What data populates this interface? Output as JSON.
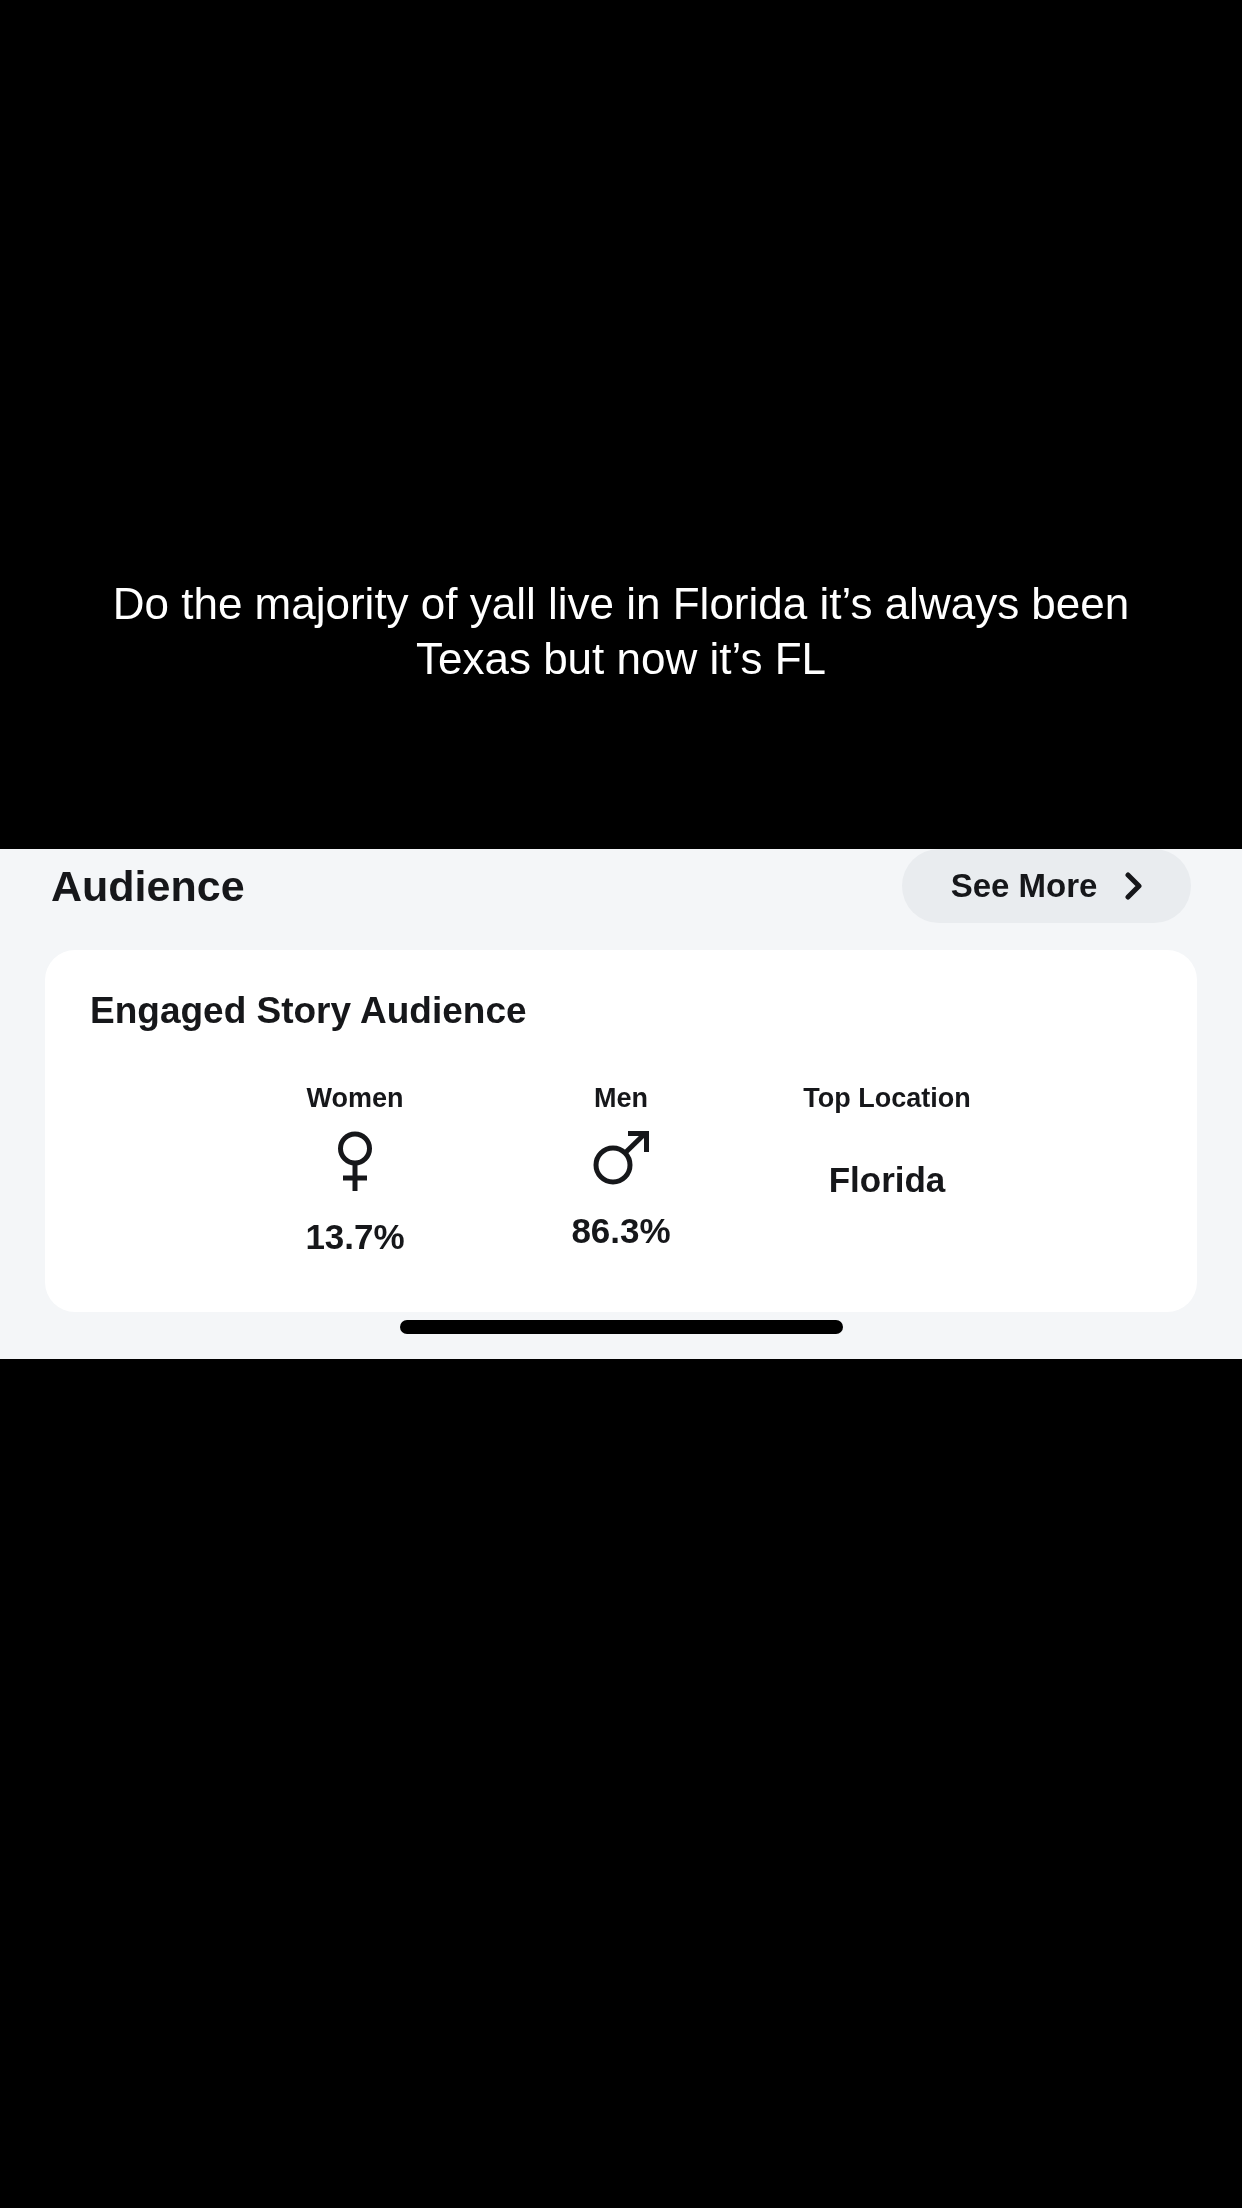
{
  "caption": "Do the majority of yall live in Florida it’s always been Texas but now it’s FL",
  "section": {
    "title": "Audience",
    "button": "See More"
  },
  "card": {
    "title": "Engaged Story Audience",
    "stats": [
      {
        "kind": "female",
        "label": "Women",
        "value": "13.7%"
      },
      {
        "kind": "male",
        "label": "Men",
        "value": "86.3%"
      },
      {
        "kind": "location",
        "label": "Top Location",
        "value": "Florida"
      }
    ]
  }
}
